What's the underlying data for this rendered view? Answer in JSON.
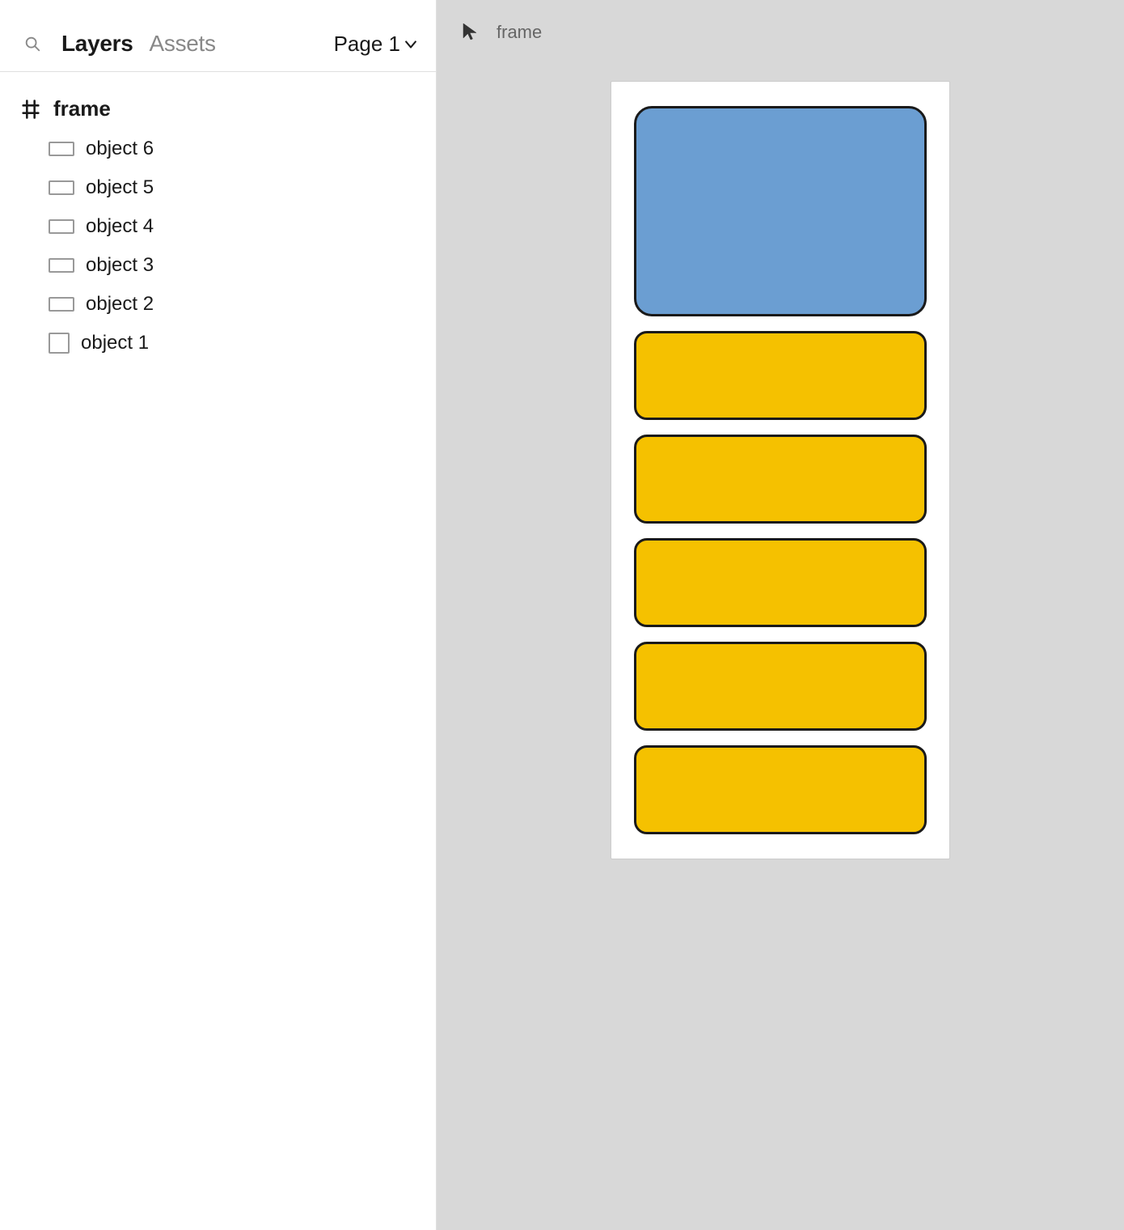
{
  "header": {
    "layers_label": "Layers",
    "assets_label": "Assets",
    "page_label": "Page 1",
    "frame_canvas_label": "frame"
  },
  "layers": {
    "frame": {
      "label": "frame",
      "icon": "frame-icon"
    },
    "items": [
      {
        "id": "object6",
        "label": "object 6",
        "icon": "rect-wide"
      },
      {
        "id": "object5",
        "label": "object 5",
        "icon": "rect-wide"
      },
      {
        "id": "object4",
        "label": "object 4",
        "icon": "rect-wide"
      },
      {
        "id": "object3",
        "label": "object 3",
        "icon": "rect-wide"
      },
      {
        "id": "object2",
        "label": "object 2",
        "icon": "rect-wide"
      },
      {
        "id": "object1",
        "label": "object 1",
        "icon": "rect-square"
      }
    ]
  },
  "canvas": {
    "objects": {
      "blue": {
        "label": "object 6 (blue square)"
      },
      "yellow_items": [
        "object 5",
        "object 4",
        "object 3",
        "object 2",
        "object 1"
      ]
    }
  },
  "colors": {
    "blue_fill": "#6b9ed2",
    "yellow_fill": "#f5c100",
    "border": "#1a1a1a",
    "frame_bg": "#ffffff",
    "canvas_bg": "#d8d8d8"
  }
}
